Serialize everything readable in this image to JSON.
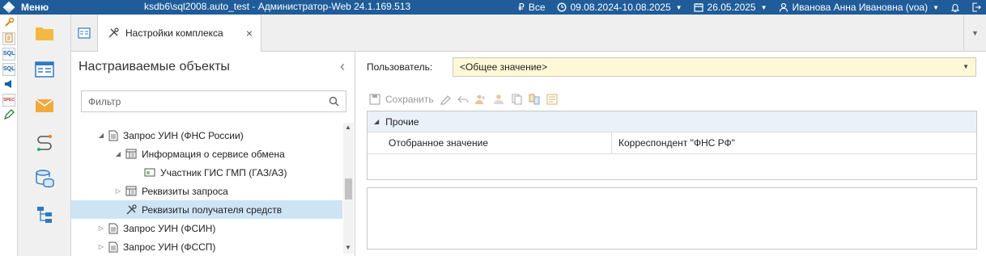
{
  "app": {
    "menu_label": "Меню",
    "window_title": "ksdb6\\sql2008.auto_test - Администратор-Web 24.1.169.513",
    "filter_all": "Все",
    "period": "09.08.2024-10.08.2025",
    "date": "26.05.2025",
    "user": "Иванова Анна Ивановна (voa)"
  },
  "leftbar": {
    "sql1": "SQL",
    "sql2": "SQL",
    "spec": "SPEC"
  },
  "tab": {
    "title": "Настройки комплекса",
    "close": "×"
  },
  "left_panel": {
    "header": "Настраиваемые объекты",
    "filter_placeholder": "Фильтр",
    "tree": [
      {
        "label": "Запрос УИН (ФНС России)",
        "toggle": "◢",
        "icon": "doc-icon",
        "level": 1,
        "selected": false
      },
      {
        "label": "Информация о сервисе обмена",
        "toggle": "◢",
        "icon": "grid-doc-icon",
        "level": 2,
        "selected": false
      },
      {
        "label": "Участник ГИС ГМП (ГАЗ/АЗ)",
        "toggle": "",
        "icon": "field-icon",
        "level": 3,
        "selected": false
      },
      {
        "label": "Реквизиты запроса",
        "toggle": "▷",
        "icon": "grid-doc-icon",
        "level": 2,
        "selected": false
      },
      {
        "label": "Реквизиты получателя средств",
        "toggle": "",
        "icon": "tools-icon",
        "level": 2,
        "selected": true
      },
      {
        "label": "Запрос УИН (ФСИН)",
        "toggle": "▷",
        "icon": "doc-icon",
        "level": 1,
        "selected": false
      },
      {
        "label": "Запрос УИН (ФССП)",
        "toggle": "▷",
        "icon": "doc-icon",
        "level": 1,
        "selected": false
      }
    ]
  },
  "right_panel": {
    "user_label": "Пользователь:",
    "user_value": "<Общее значение>",
    "save_label": "Сохранить",
    "group_label": "Прочие",
    "property_name": "Отобранное значение",
    "property_value": "Корреспондент \"ФНС РФ\""
  },
  "colors": {
    "titlebar": "#1f5c99",
    "selected_row": "#cde4f5",
    "user_field": "#fff8d6",
    "group_row": "#e9f1f9"
  }
}
